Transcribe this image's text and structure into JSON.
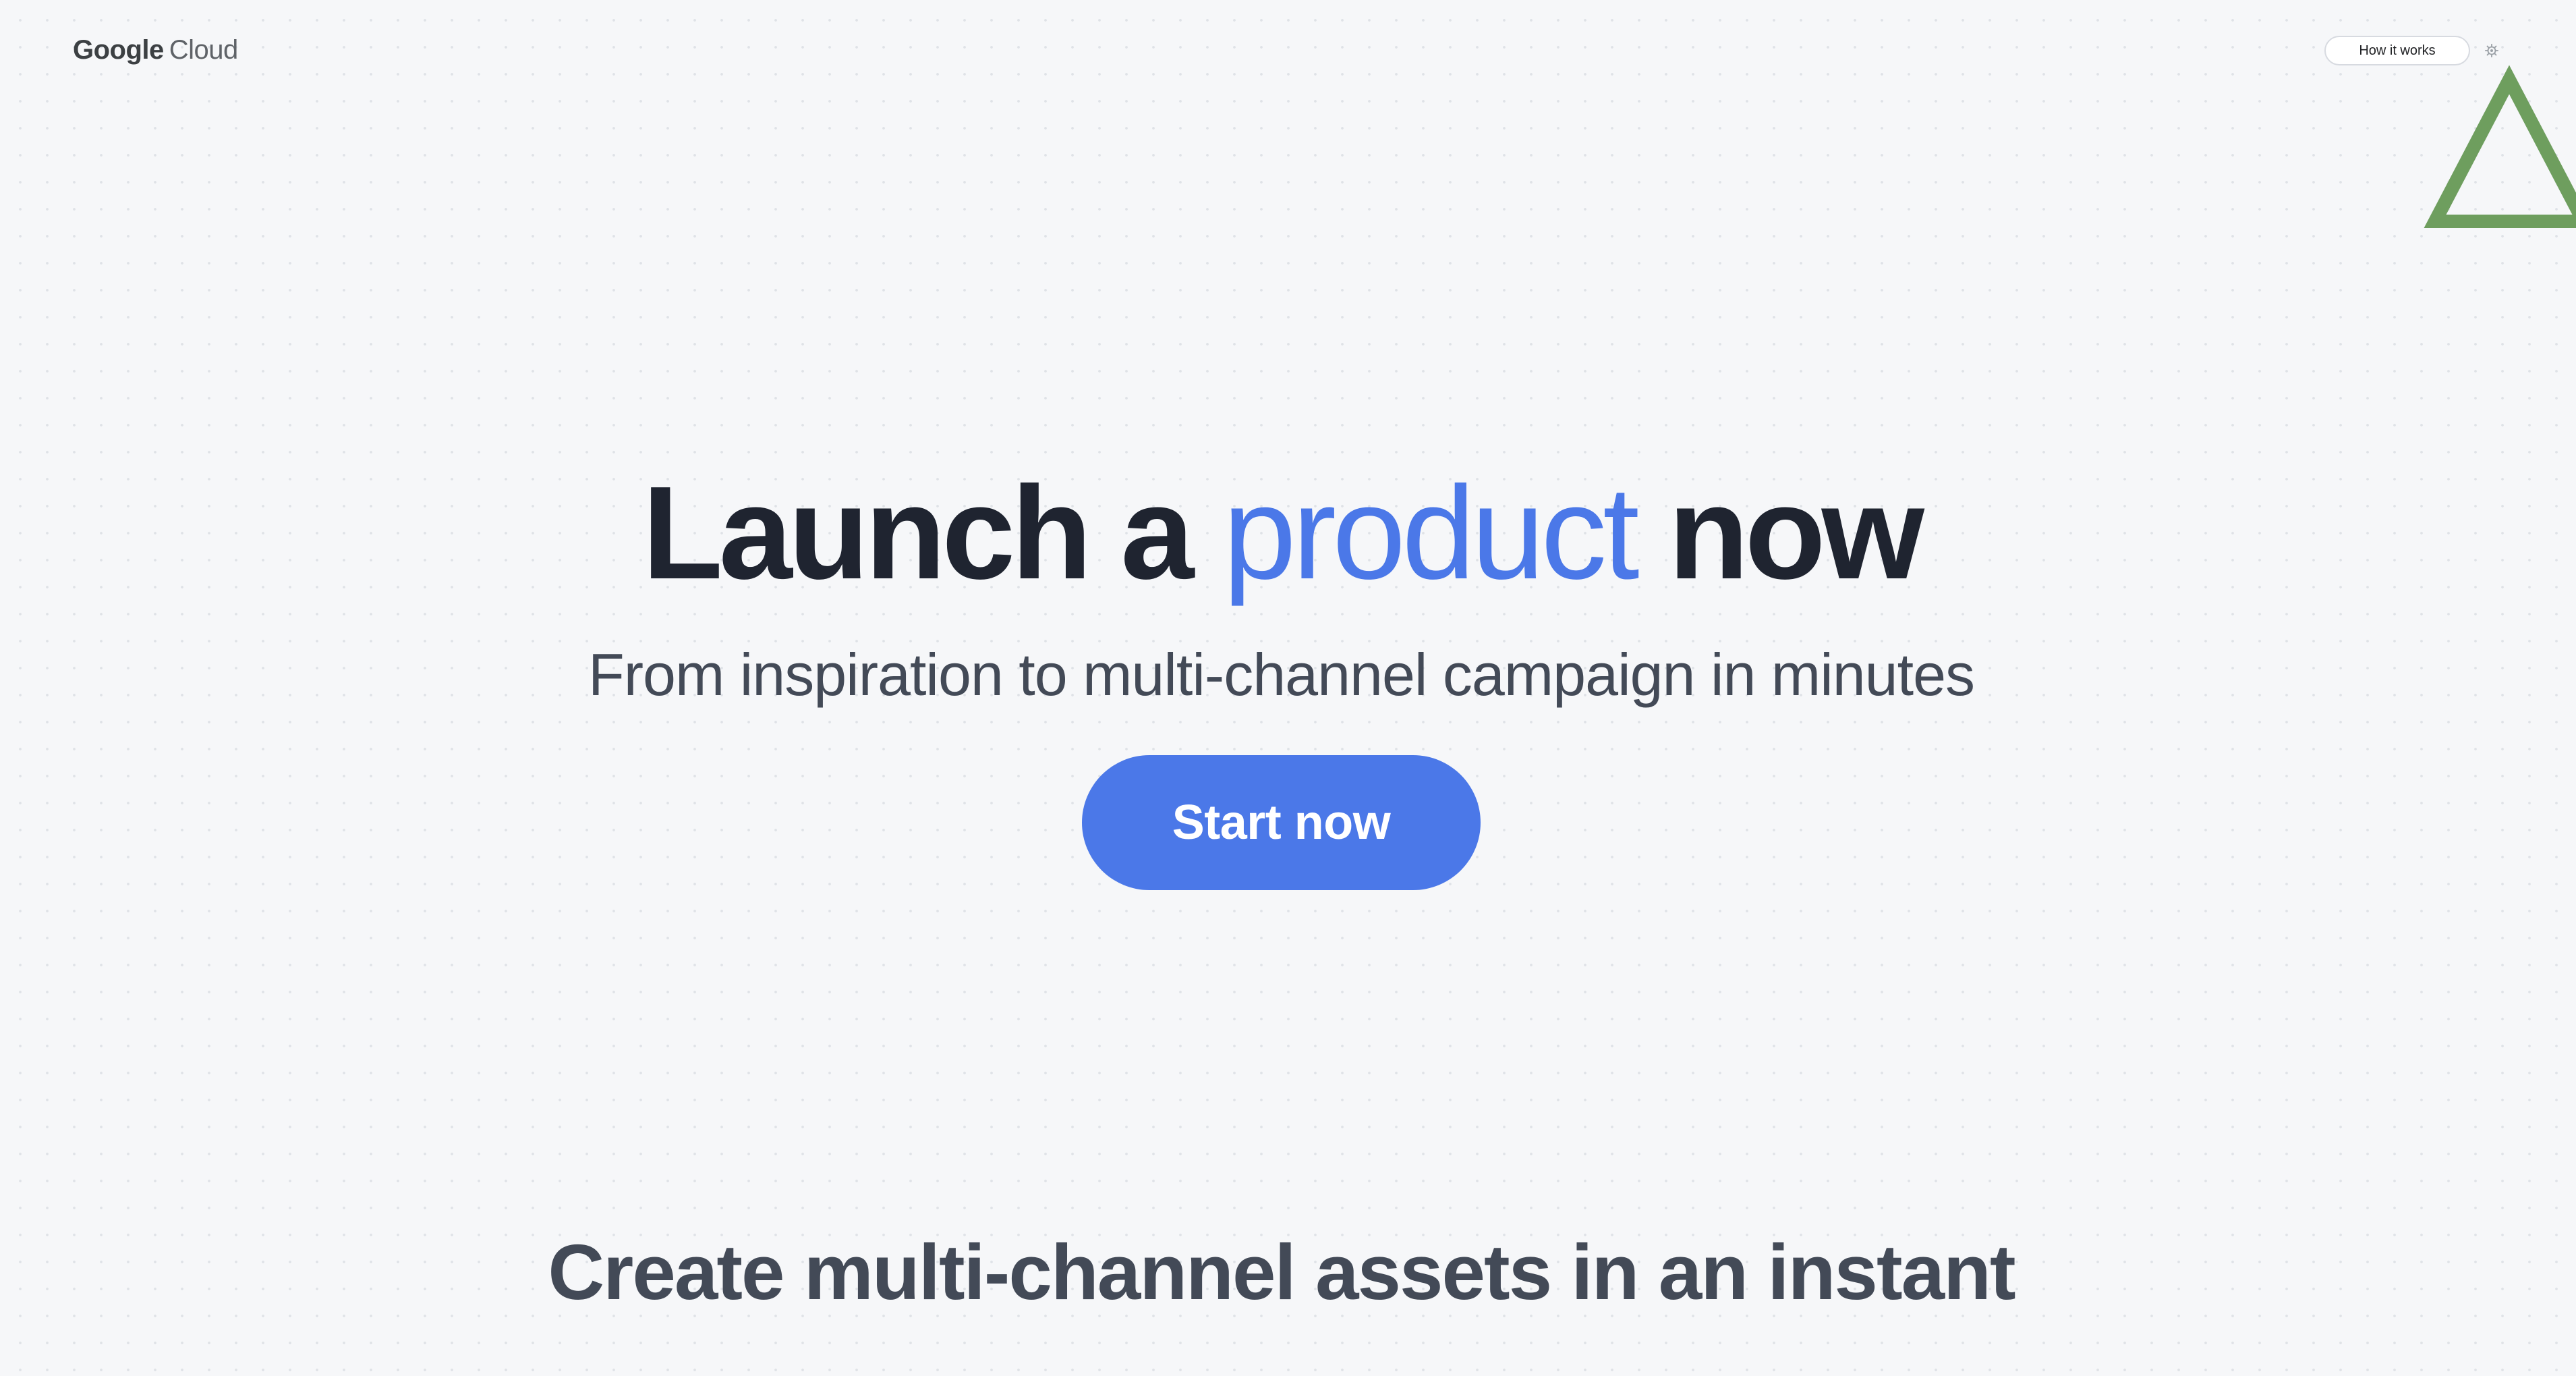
{
  "header": {
    "logo_brand": "Google",
    "logo_product": "Cloud",
    "how_it_works_label": "How it works",
    "settings_icon": "settings-icon"
  },
  "hero": {
    "title_prefix": "Launch a ",
    "title_accent": "product",
    "title_suffix": " now",
    "subtitle": "From inspiration to multi-channel campaign in minutes",
    "cta_label": "Start now"
  },
  "section": {
    "heading": "Create multi-channel assets in an instant"
  },
  "colors": {
    "accent": "#4b78e8",
    "title_dark": "#1f2430",
    "body_text": "#434a57",
    "decor_triangle": "#6e9e5e",
    "background": "#f6f7f9"
  },
  "decor": {
    "shape": "triangle-outline"
  }
}
